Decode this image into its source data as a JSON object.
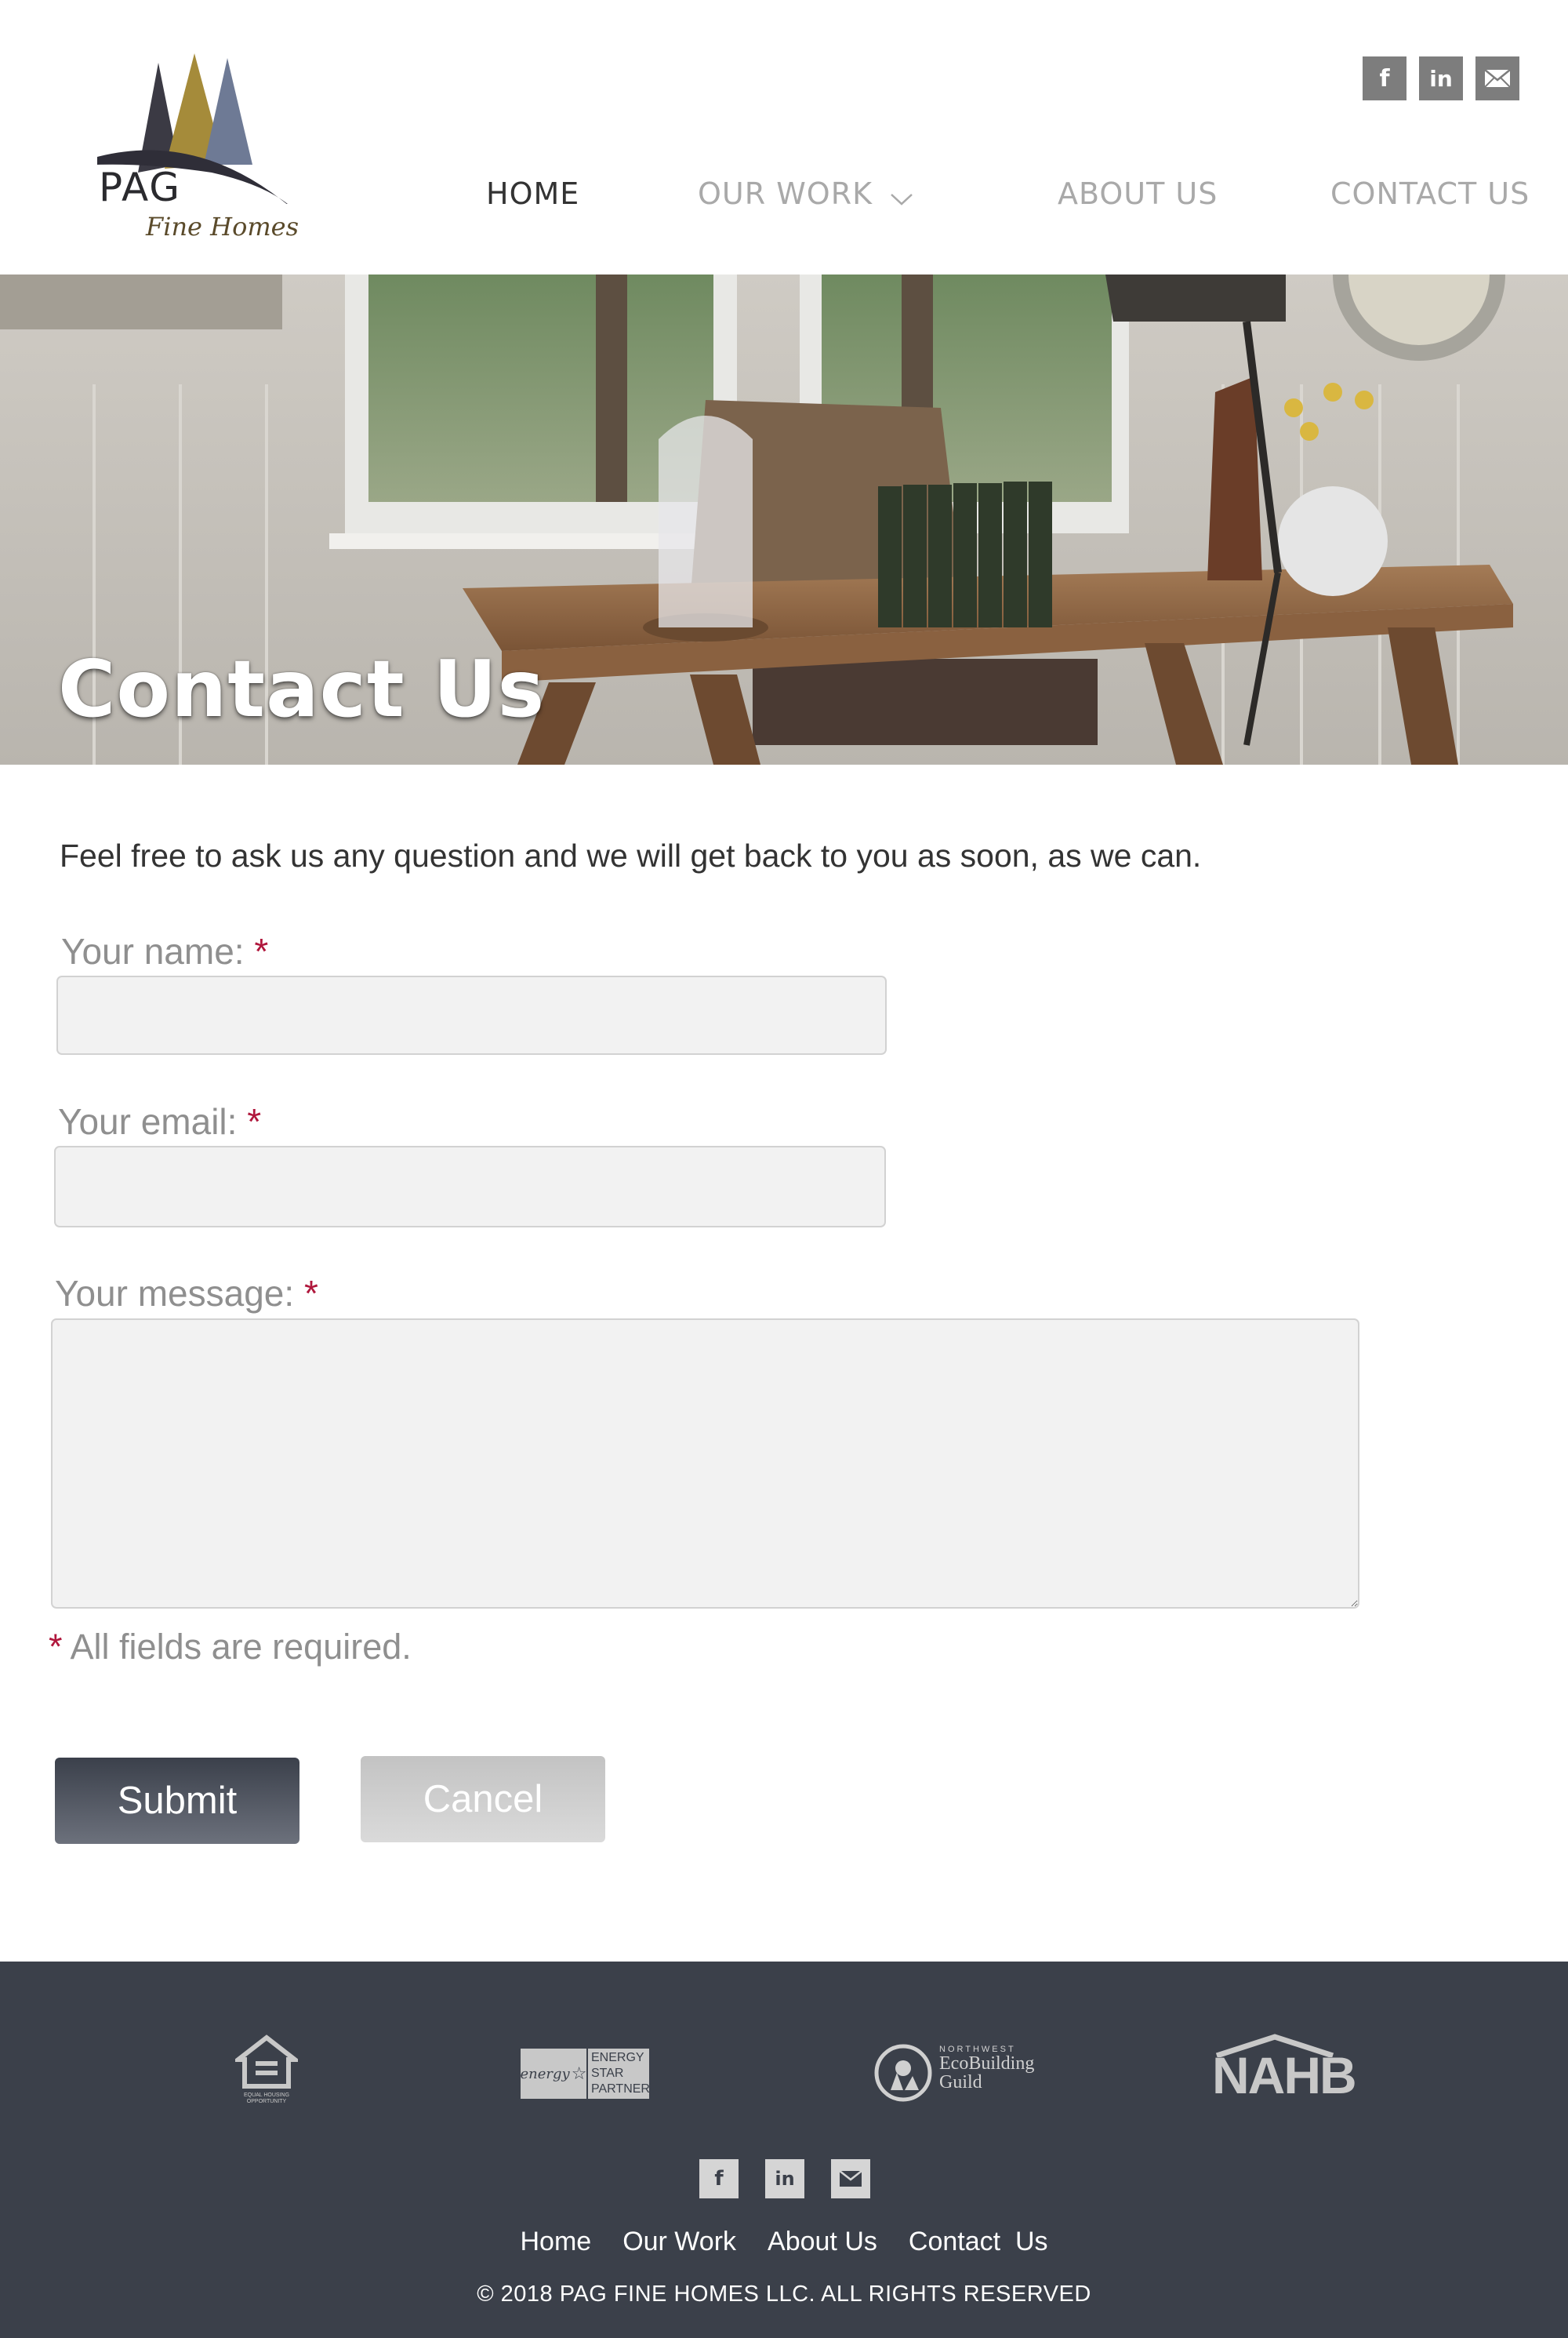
{
  "brand": {
    "name": "PAG",
    "tagline": "Fine Homes"
  },
  "header": {
    "social": [
      {
        "icon": "facebook-icon",
        "glyph": "f"
      },
      {
        "icon": "linkedin-icon",
        "glyph": "in"
      },
      {
        "icon": "mail-icon",
        "glyph": ""
      }
    ],
    "nav": {
      "home": "HOME",
      "our_work": "OUR WORK",
      "about_us": "ABOUT US",
      "contact_us": "CONTACT US"
    }
  },
  "hero": {
    "title": "Contact Us"
  },
  "form": {
    "intro": "Feel free to ask us any question and we will get back to you as soon, as we can.",
    "name_label": "Your name:",
    "email_label": "Your email:",
    "message_label": "Your message:",
    "required_mark": "*",
    "name_value": "",
    "email_value": "",
    "message_value": "",
    "required_note": "All fields are required.",
    "submit_label": "Submit",
    "cancel_label": "Cancel"
  },
  "footer": {
    "logos": {
      "energy_star": [
        "ENERGY",
        "STAR",
        "PARTNER"
      ],
      "energy_script": "energy",
      "ecobuilding": [
        "NORTHWEST",
        "EcoBuilding",
        "Guild"
      ],
      "nahb": "NAHB",
      "equal_housing": "EQUAL HOUSING OPPORTUNITY"
    },
    "social": [
      {
        "icon": "facebook-icon",
        "glyph": "f"
      },
      {
        "icon": "linkedin-icon",
        "glyph": "in"
      },
      {
        "icon": "mail-icon",
        "glyph": ""
      }
    ],
    "nav": {
      "home": "Home",
      "our_work": "Our Work",
      "about_us": "About Us",
      "contact_us": "Contact  Us"
    },
    "copyright": "© 2018 PAG FINE HOMES LLC. ALL RIGHTS RESERVED"
  },
  "colors": {
    "accent_dark": "#3b404a",
    "required": "#b0173c",
    "nav_inactive": "#a9a9a9",
    "logo_gold": "#a58b3a",
    "logo_blue": "#6e7a95"
  }
}
